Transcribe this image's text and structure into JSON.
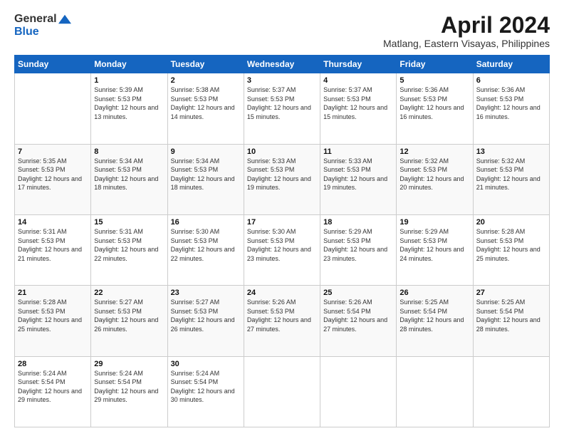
{
  "logo": {
    "general": "General",
    "blue": "Blue"
  },
  "header": {
    "month_title": "April 2024",
    "location": "Matlang, Eastern Visayas, Philippines"
  },
  "weekdays": [
    "Sunday",
    "Monday",
    "Tuesday",
    "Wednesday",
    "Thursday",
    "Friday",
    "Saturday"
  ],
  "weeks": [
    [
      {
        "day": "",
        "sunrise": "",
        "sunset": "",
        "daylight": ""
      },
      {
        "day": "1",
        "sunrise": "Sunrise: 5:39 AM",
        "sunset": "Sunset: 5:53 PM",
        "daylight": "Daylight: 12 hours and 13 minutes."
      },
      {
        "day": "2",
        "sunrise": "Sunrise: 5:38 AM",
        "sunset": "Sunset: 5:53 PM",
        "daylight": "Daylight: 12 hours and 14 minutes."
      },
      {
        "day": "3",
        "sunrise": "Sunrise: 5:37 AM",
        "sunset": "Sunset: 5:53 PM",
        "daylight": "Daylight: 12 hours and 15 minutes."
      },
      {
        "day": "4",
        "sunrise": "Sunrise: 5:37 AM",
        "sunset": "Sunset: 5:53 PM",
        "daylight": "Daylight: 12 hours and 15 minutes."
      },
      {
        "day": "5",
        "sunrise": "Sunrise: 5:36 AM",
        "sunset": "Sunset: 5:53 PM",
        "daylight": "Daylight: 12 hours and 16 minutes."
      },
      {
        "day": "6",
        "sunrise": "Sunrise: 5:36 AM",
        "sunset": "Sunset: 5:53 PM",
        "daylight": "Daylight: 12 hours and 16 minutes."
      }
    ],
    [
      {
        "day": "7",
        "sunrise": "Sunrise: 5:35 AM",
        "sunset": "Sunset: 5:53 PM",
        "daylight": "Daylight: 12 hours and 17 minutes."
      },
      {
        "day": "8",
        "sunrise": "Sunrise: 5:34 AM",
        "sunset": "Sunset: 5:53 PM",
        "daylight": "Daylight: 12 hours and 18 minutes."
      },
      {
        "day": "9",
        "sunrise": "Sunrise: 5:34 AM",
        "sunset": "Sunset: 5:53 PM",
        "daylight": "Daylight: 12 hours and 18 minutes."
      },
      {
        "day": "10",
        "sunrise": "Sunrise: 5:33 AM",
        "sunset": "Sunset: 5:53 PM",
        "daylight": "Daylight: 12 hours and 19 minutes."
      },
      {
        "day": "11",
        "sunrise": "Sunrise: 5:33 AM",
        "sunset": "Sunset: 5:53 PM",
        "daylight": "Daylight: 12 hours and 19 minutes."
      },
      {
        "day": "12",
        "sunrise": "Sunrise: 5:32 AM",
        "sunset": "Sunset: 5:53 PM",
        "daylight": "Daylight: 12 hours and 20 minutes."
      },
      {
        "day": "13",
        "sunrise": "Sunrise: 5:32 AM",
        "sunset": "Sunset: 5:53 PM",
        "daylight": "Daylight: 12 hours and 21 minutes."
      }
    ],
    [
      {
        "day": "14",
        "sunrise": "Sunrise: 5:31 AM",
        "sunset": "Sunset: 5:53 PM",
        "daylight": "Daylight: 12 hours and 21 minutes."
      },
      {
        "day": "15",
        "sunrise": "Sunrise: 5:31 AM",
        "sunset": "Sunset: 5:53 PM",
        "daylight": "Daylight: 12 hours and 22 minutes."
      },
      {
        "day": "16",
        "sunrise": "Sunrise: 5:30 AM",
        "sunset": "Sunset: 5:53 PM",
        "daylight": "Daylight: 12 hours and 22 minutes."
      },
      {
        "day": "17",
        "sunrise": "Sunrise: 5:30 AM",
        "sunset": "Sunset: 5:53 PM",
        "daylight": "Daylight: 12 hours and 23 minutes."
      },
      {
        "day": "18",
        "sunrise": "Sunrise: 5:29 AM",
        "sunset": "Sunset: 5:53 PM",
        "daylight": "Daylight: 12 hours and 23 minutes."
      },
      {
        "day": "19",
        "sunrise": "Sunrise: 5:29 AM",
        "sunset": "Sunset: 5:53 PM",
        "daylight": "Daylight: 12 hours and 24 minutes."
      },
      {
        "day": "20",
        "sunrise": "Sunrise: 5:28 AM",
        "sunset": "Sunset: 5:53 PM",
        "daylight": "Daylight: 12 hours and 25 minutes."
      }
    ],
    [
      {
        "day": "21",
        "sunrise": "Sunrise: 5:28 AM",
        "sunset": "Sunset: 5:53 PM",
        "daylight": "Daylight: 12 hours and 25 minutes."
      },
      {
        "day": "22",
        "sunrise": "Sunrise: 5:27 AM",
        "sunset": "Sunset: 5:53 PM",
        "daylight": "Daylight: 12 hours and 26 minutes."
      },
      {
        "day": "23",
        "sunrise": "Sunrise: 5:27 AM",
        "sunset": "Sunset: 5:53 PM",
        "daylight": "Daylight: 12 hours and 26 minutes."
      },
      {
        "day": "24",
        "sunrise": "Sunrise: 5:26 AM",
        "sunset": "Sunset: 5:53 PM",
        "daylight": "Daylight: 12 hours and 27 minutes."
      },
      {
        "day": "25",
        "sunrise": "Sunrise: 5:26 AM",
        "sunset": "Sunset: 5:54 PM",
        "daylight": "Daylight: 12 hours and 27 minutes."
      },
      {
        "day": "26",
        "sunrise": "Sunrise: 5:25 AM",
        "sunset": "Sunset: 5:54 PM",
        "daylight": "Daylight: 12 hours and 28 minutes."
      },
      {
        "day": "27",
        "sunrise": "Sunrise: 5:25 AM",
        "sunset": "Sunset: 5:54 PM",
        "daylight": "Daylight: 12 hours and 28 minutes."
      }
    ],
    [
      {
        "day": "28",
        "sunrise": "Sunrise: 5:24 AM",
        "sunset": "Sunset: 5:54 PM",
        "daylight": "Daylight: 12 hours and 29 minutes."
      },
      {
        "day": "29",
        "sunrise": "Sunrise: 5:24 AM",
        "sunset": "Sunset: 5:54 PM",
        "daylight": "Daylight: 12 hours and 29 minutes."
      },
      {
        "day": "30",
        "sunrise": "Sunrise: 5:24 AM",
        "sunset": "Sunset: 5:54 PM",
        "daylight": "Daylight: 12 hours and 30 minutes."
      },
      {
        "day": "",
        "sunrise": "",
        "sunset": "",
        "daylight": ""
      },
      {
        "day": "",
        "sunrise": "",
        "sunset": "",
        "daylight": ""
      },
      {
        "day": "",
        "sunrise": "",
        "sunset": "",
        "daylight": ""
      },
      {
        "day": "",
        "sunrise": "",
        "sunset": "",
        "daylight": ""
      }
    ]
  ]
}
